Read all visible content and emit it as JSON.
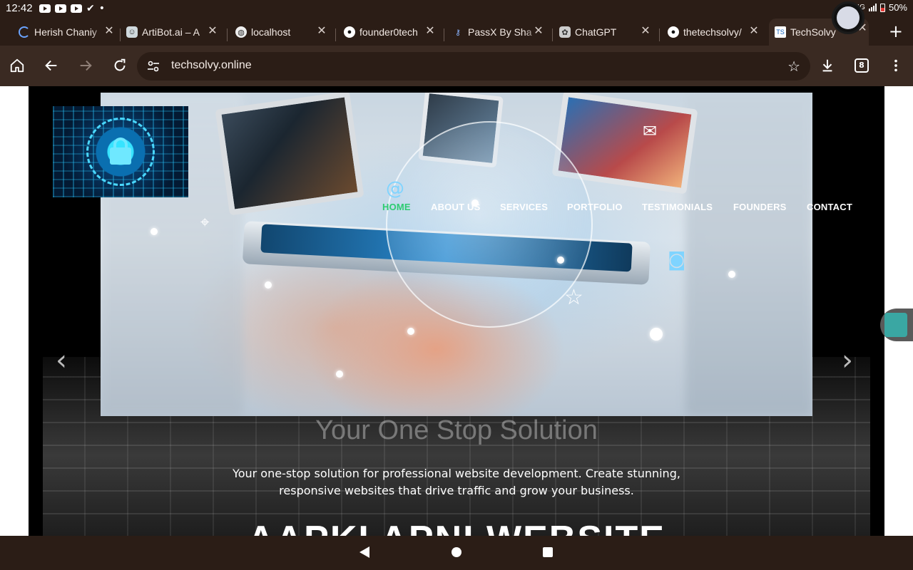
{
  "status_bar": {
    "time": "12:42",
    "network": "4G",
    "battery": "50%"
  },
  "tabs": [
    {
      "title": "Herish Chaniy",
      "favicon": "loading-spinner-icon"
    },
    {
      "title": "ArtiBot.ai – A",
      "favicon": "robot-icon"
    },
    {
      "title": "localhost",
      "favicon": "globe-icon"
    },
    {
      "title": "founder0tech",
      "favicon": "github-icon"
    },
    {
      "title": "PassX By Sha",
      "favicon": "passx-icon"
    },
    {
      "title": "ChatGPT",
      "favicon": "chatgpt-icon"
    },
    {
      "title": "thetechsolvy/",
      "favicon": "github-icon"
    },
    {
      "title": "TechSolvy",
      "favicon": "techsolvy-icon",
      "active": true
    }
  ],
  "toolbar": {
    "url": "techsolvy.online",
    "tab_count": "8"
  },
  "site": {
    "nav": [
      "HOME",
      "ABOUT US",
      "SERVICES",
      "PORTFOLIO",
      "TESTIMONIALS",
      "FOUNDERS",
      "CONTACT"
    ],
    "nav_active_color": "#2ecc71",
    "headline": "Your One Stop Solution",
    "tagline_line1": "Your one-stop solution for professional website development. Create stunning,",
    "tagline_line2": "responsive websites that drive traffic and grow your business.",
    "big_title": "AAPKI APNI WEBSITE",
    "prev_arrow": "‹",
    "next_arrow": "›"
  }
}
